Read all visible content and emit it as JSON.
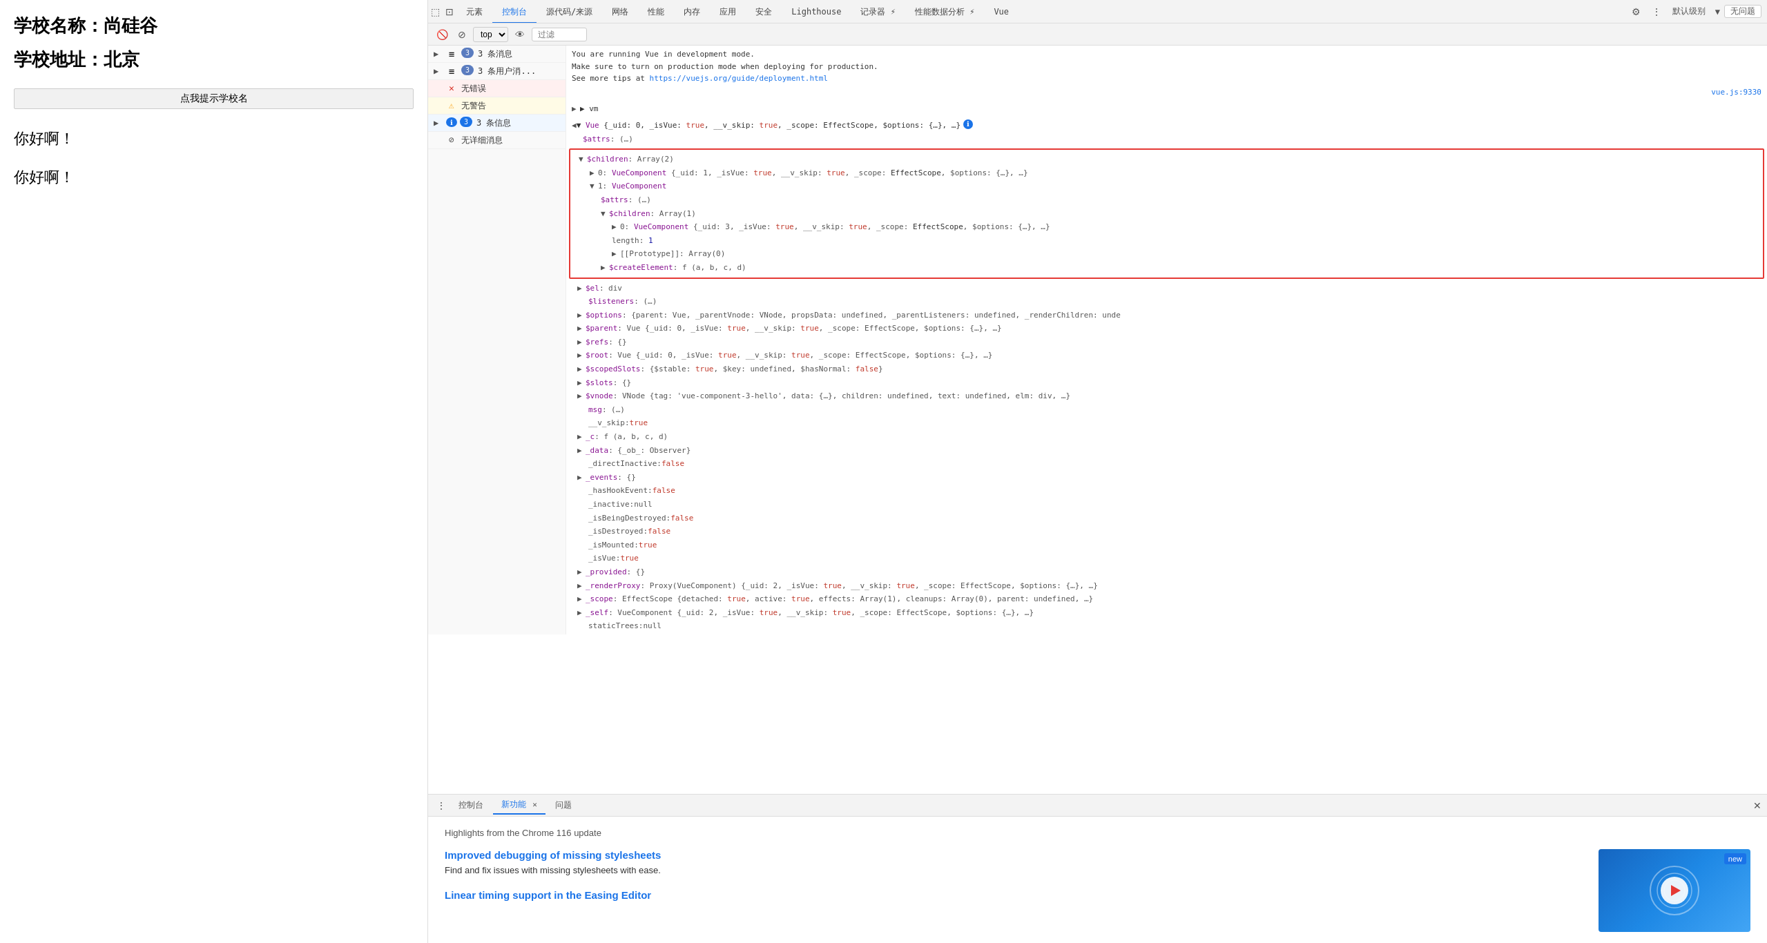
{
  "leftPane": {
    "schoolName": "学校名称：尚硅谷",
    "schoolAddress": "学校地址：北京",
    "btnLabel": "点我提示学校名",
    "hello1": "你好啊！",
    "hello2": "你好啊！"
  },
  "devtools": {
    "topTabs": [
      {
        "label": "元素",
        "active": false
      },
      {
        "label": "控制台",
        "active": true
      },
      {
        "label": "源代码/来源",
        "active": false
      },
      {
        "label": "网络",
        "active": false
      },
      {
        "label": "性能",
        "active": false
      },
      {
        "label": "内存",
        "active": false
      },
      {
        "label": "应用",
        "active": false
      },
      {
        "label": "安全",
        "active": false
      },
      {
        "label": "Lighthouse",
        "active": false
      },
      {
        "label": "记录器 ⚡",
        "active": false
      },
      {
        "label": "性能数据分析 ⚡",
        "active": false
      },
      {
        "label": "Vue",
        "active": false
      }
    ],
    "rightOptions": {
      "defaultLevelLabel": "默认级别",
      "noIssues": "无问题"
    },
    "toolbar2": {
      "topLabel": "top",
      "filterPlaceholder": "过滤"
    },
    "consoleMessages": [
      {
        "type": "grouped",
        "count": "3",
        "label": "3 条消息",
        "icon": "list"
      },
      {
        "type": "grouped",
        "count": "3",
        "label": "3 条用户消...",
        "icon": "list"
      },
      {
        "type": "error",
        "count": null,
        "label": "无错误",
        "icon": "error"
      },
      {
        "type": "warning",
        "count": null,
        "label": "无警告",
        "icon": "warning"
      },
      {
        "type": "grouped-info",
        "count": "3",
        "label": "3 条信息",
        "icon": "info"
      },
      {
        "type": "none",
        "count": null,
        "label": "无详细消息",
        "icon": "none"
      }
    ],
    "vueRunningMsg": {
      "line1": "You are running Vue in development mode.",
      "line2": "Make sure to turn on production mode when deploying for production.",
      "line3Pre": "See more tips at ",
      "line3Link": "https://vuejs.org/guide/deployment.html",
      "source": "vue.js:9330"
    },
    "vmLabel": "▶ vm",
    "vmArrow": "◀",
    "vmMain": "▼ Vue {_uid: 0, _isVue: true, __v_skip: true, _scope: EffectScope, $options: {…}, …}",
    "infoIconLabel": "ℹ",
    "attrsLabel": "$attrs: (…)",
    "highlightedBlock": {
      "childrenLabel": "▼ $children: Array(2)",
      "child0": "▶ 0: VueComponent {_uid: 1, _isVue: true, __v_skip: true, _scope: EffectScope, $options: {…}, …}",
      "child1collapsed": "▼ 1: VueComponent",
      "child1attrs": "$attrs: (…)",
      "child1children": "▼ $children: Array(1)",
      "child1child0": "▶ 0: VueComponent {_uid: 3, _isVue: true, __v_skip: true, _scope: EffectScope, $options: {…}, …}",
      "child1length": "length: 1",
      "child1proto": "▶ [[Prototype]]: Array(0)",
      "child1createElement": "▶ $createElement: f (a, b, c, d)"
    },
    "vmProperties": [
      "▶ $el: div",
      "$listeners: (…)",
      "▶ $options: {parent: Vue, _parentVnode: VNode, propsData: undefined, _parentListeners: undefined, _renderChildren: unde",
      "▶ $parent: Vue {_uid: 0, _isVue: true, __v_skip: true, _scope: EffectScope, $options: {…}, …}",
      "▶ $refs: {}",
      "▶ $root: Vue {_uid: 0, _isVue: true, __v_skip: true, _scope: EffectScope, $options: {…}, …}",
      "▶ $scopedSlots: {$stable: true, $key: undefined, $hasNormal: false}",
      "▶ $slots: {}",
      "▶ $vnode: VNode {tag: 'vue-component-3-hello', data: {…}, children: undefined, text: undefined, elm: div, …}",
      "msg:  (…)",
      "__v_skip: true",
      "▶ _c: f (a, b, c, d)",
      "▶ _data: {_ob_: Observer}",
      "_directInactive: false",
      "▶ _events: {}",
      "_hasHookEvent: false",
      "_inactive: null",
      "_isBeingDestroyed: false",
      "_isDestroyed: false",
      "_isMounted: true",
      "_isVue: true",
      "▶ _provided: {}",
      "▶ _renderProxy: Proxy(VueComponent) {_uid: 2, _isVue: true, __v_skip: true, _scope: EffectScope, $options: {…}, …}",
      "▶ _scope: EffectScope {detached: true, active: true, effects: Array(1), cleanups: Array(0), parent: undefined, …}",
      "▶ _self: VueComponent {_uid: 2, _isVue: true, __v_skip: true, _scope: EffectScope, $options: {…}, …}",
      "staticTrees: null"
    ]
  },
  "bottomPanel": {
    "tabs": [
      {
        "label": "控制台",
        "active": false
      },
      {
        "label": "新功能",
        "active": true,
        "closeable": true
      },
      {
        "label": "问题",
        "active": false
      }
    ],
    "newFeatures": {
      "title": "Highlights from the Chrome 116 update",
      "feature1": {
        "title": "Improved debugging of missing stylesheets",
        "desc": "Find and fix issues with missing stylesheets with ease."
      },
      "feature2": {
        "title": "Linear timing support in the Easing Editor"
      },
      "videoBadge": "new"
    }
  },
  "icons": {
    "gear": "⚙",
    "more": "⋮",
    "dock": "⊡",
    "undock": "⊞",
    "eye": "👁",
    "ban": "🚫",
    "filter": "≡",
    "list": "≡",
    "error": "✕",
    "warning": "⚠",
    "info": "ℹ",
    "expand": "▶",
    "collapse": "▼"
  }
}
